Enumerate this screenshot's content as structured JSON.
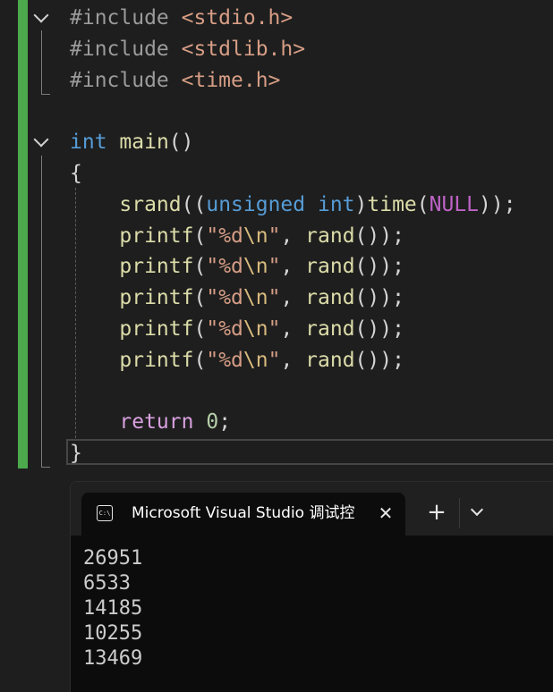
{
  "editor": {
    "lines": [
      [
        {
          "t": "#include ",
          "c": "directive"
        },
        {
          "t": "<stdio.h>",
          "c": "string-inc"
        }
      ],
      [
        {
          "t": "#include ",
          "c": "directive"
        },
        {
          "t": "<stdlib.h>",
          "c": "string-inc"
        }
      ],
      [
        {
          "t": "#include ",
          "c": "directive"
        },
        {
          "t": "<time.h>",
          "c": "string-inc"
        }
      ],
      [],
      [
        {
          "t": "int",
          "c": "keyword"
        },
        {
          "t": " ",
          "c": "punc"
        },
        {
          "t": "main",
          "c": "func"
        },
        {
          "t": "()",
          "c": "punc"
        }
      ],
      [
        {
          "t": "{",
          "c": "punc"
        }
      ],
      [
        {
          "t": "    ",
          "c": "punc"
        },
        {
          "t": "srand",
          "c": "func"
        },
        {
          "t": "((",
          "c": "punc"
        },
        {
          "t": "unsigned",
          "c": "keyword"
        },
        {
          "t": " ",
          "c": "punc"
        },
        {
          "t": "int",
          "c": "keyword"
        },
        {
          "t": ")",
          "c": "punc"
        },
        {
          "t": "time",
          "c": "func"
        },
        {
          "t": "(",
          "c": "punc"
        },
        {
          "t": "NULL",
          "c": "macro"
        },
        {
          "t": "));",
          "c": "punc"
        }
      ],
      [
        {
          "t": "    ",
          "c": "punc"
        },
        {
          "t": "printf",
          "c": "func"
        },
        {
          "t": "(",
          "c": "punc"
        },
        {
          "t": "\"%d",
          "c": "string"
        },
        {
          "t": "\\n",
          "c": "escape"
        },
        {
          "t": "\"",
          "c": "string"
        },
        {
          "t": ", ",
          "c": "punc"
        },
        {
          "t": "rand",
          "c": "func"
        },
        {
          "t": "());",
          "c": "punc"
        }
      ],
      [
        {
          "t": "    ",
          "c": "punc"
        },
        {
          "t": "printf",
          "c": "func"
        },
        {
          "t": "(",
          "c": "punc"
        },
        {
          "t": "\"%d",
          "c": "string"
        },
        {
          "t": "\\n",
          "c": "escape"
        },
        {
          "t": "\"",
          "c": "string"
        },
        {
          "t": ", ",
          "c": "punc"
        },
        {
          "t": "rand",
          "c": "func"
        },
        {
          "t": "());",
          "c": "punc"
        }
      ],
      [
        {
          "t": "    ",
          "c": "punc"
        },
        {
          "t": "printf",
          "c": "func"
        },
        {
          "t": "(",
          "c": "punc"
        },
        {
          "t": "\"%d",
          "c": "string"
        },
        {
          "t": "\\n",
          "c": "escape"
        },
        {
          "t": "\"",
          "c": "string"
        },
        {
          "t": ", ",
          "c": "punc"
        },
        {
          "t": "rand",
          "c": "func"
        },
        {
          "t": "());",
          "c": "punc"
        }
      ],
      [
        {
          "t": "    ",
          "c": "punc"
        },
        {
          "t": "printf",
          "c": "func"
        },
        {
          "t": "(",
          "c": "punc"
        },
        {
          "t": "\"%d",
          "c": "string"
        },
        {
          "t": "\\n",
          "c": "escape"
        },
        {
          "t": "\"",
          "c": "string"
        },
        {
          "t": ", ",
          "c": "punc"
        },
        {
          "t": "rand",
          "c": "func"
        },
        {
          "t": "());",
          "c": "punc"
        }
      ],
      [
        {
          "t": "    ",
          "c": "punc"
        },
        {
          "t": "printf",
          "c": "func"
        },
        {
          "t": "(",
          "c": "punc"
        },
        {
          "t": "\"%d",
          "c": "string"
        },
        {
          "t": "\\n",
          "c": "escape"
        },
        {
          "t": "\"",
          "c": "string"
        },
        {
          "t": ", ",
          "c": "punc"
        },
        {
          "t": "rand",
          "c": "func"
        },
        {
          "t": "());",
          "c": "punc"
        }
      ],
      [],
      [
        {
          "t": "    ",
          "c": "punc"
        },
        {
          "t": "return",
          "c": "control"
        },
        {
          "t": " ",
          "c": "punc"
        },
        {
          "t": "0",
          "c": "number"
        },
        {
          "t": ";",
          "c": "punc"
        }
      ],
      [
        {
          "t": "}",
          "c": "punc"
        }
      ]
    ]
  },
  "terminal": {
    "tab_title": "Microsoft Visual Studio 调试控",
    "tab_icon_text": "C:\\",
    "close_glyph": "✕",
    "new_tab_glyph": "+",
    "output": [
      "26951",
      "6533",
      "14185",
      "10255",
      "13469"
    ]
  },
  "colors": {
    "change_bar": "#4caa4c",
    "editor_bg": "#1e1e1e",
    "terminal_bg": "#0c0c0c"
  }
}
